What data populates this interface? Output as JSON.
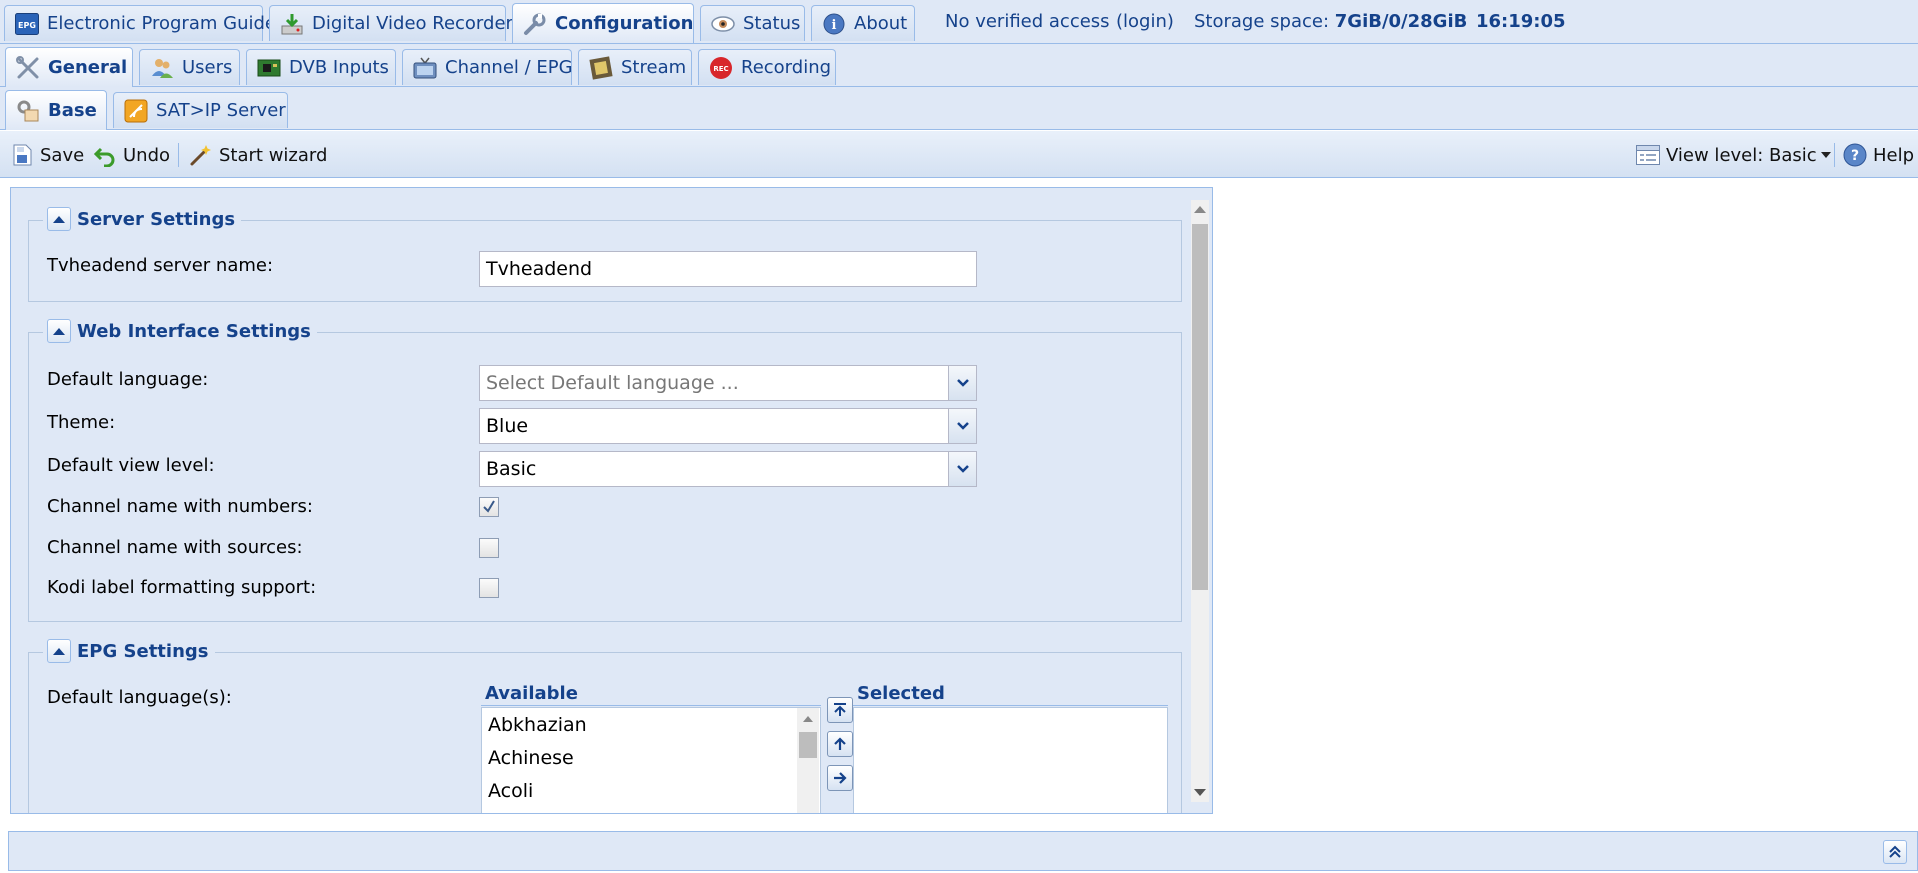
{
  "top_tabs": [
    {
      "label": "Electronic Program Guide",
      "icon": "epg-icon"
    },
    {
      "label": "Digital Video Recorder",
      "icon": "dvr-icon"
    },
    {
      "label": "Configuration",
      "icon": "wrench-icon",
      "active": true
    },
    {
      "label": "Status",
      "icon": "eye-icon"
    },
    {
      "label": "About",
      "icon": "info-icon"
    }
  ],
  "status": {
    "access": "No verified access",
    "login": "(login)",
    "storage_label": "Storage space:",
    "storage_value": "7GiB/0/28GiB",
    "time": "16:19:05"
  },
  "config_tabs": [
    {
      "label": "General",
      "icon": "tools-icon",
      "active": true
    },
    {
      "label": "Users",
      "icon": "users-icon"
    },
    {
      "label": "DVB Inputs",
      "icon": "chip-icon"
    },
    {
      "label": "Channel / EPG",
      "icon": "tv-icon"
    },
    {
      "label": "Stream",
      "icon": "film-icon"
    },
    {
      "label": "Recording",
      "icon": "rec-icon"
    }
  ],
  "general_tabs": [
    {
      "label": "Base",
      "icon": "base-icon",
      "active": true
    },
    {
      "label": "SAT>IP Server",
      "icon": "satip-icon"
    }
  ],
  "toolbar": {
    "save": "Save",
    "undo": "Undo",
    "wizard": "Start wizard",
    "view_level": "View level: Basic",
    "help": "Help"
  },
  "server_settings": {
    "title": "Server Settings",
    "server_name_label": "Tvheadend server name:",
    "server_name_value": "Tvheadend"
  },
  "web_settings": {
    "title": "Web Interface Settings",
    "default_language_label": "Default language:",
    "default_language_placeholder": "Select Default language ...",
    "theme_label": "Theme:",
    "theme_value": "Blue",
    "view_level_label": "Default view level:",
    "view_level_value": "Basic",
    "chan_numbers_label": "Channel name with numbers:",
    "chan_numbers_checked": true,
    "chan_sources_label": "Channel name with sources:",
    "chan_sources_checked": false,
    "kodi_label": "Kodi label formatting support:",
    "kodi_checked": false
  },
  "epg_settings": {
    "title": "EPG Settings",
    "languages_label": "Default language(s):",
    "available_header": "Available",
    "selected_header": "Selected",
    "available": [
      "Abkhazian",
      "Achinese",
      "Acoli"
    ],
    "selected": []
  }
}
